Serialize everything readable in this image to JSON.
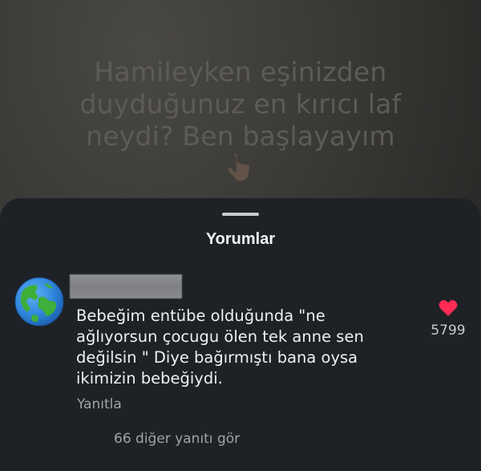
{
  "video": {
    "caption_lines": [
      "Hamileyken eşinizden",
      "duyduğunuz en kırıcı laf",
      "neydi? Ben başlayayım"
    ],
    "emoji": "pointing-down-hand"
  },
  "comments_sheet": {
    "title": "Yorumlar",
    "comment": {
      "avatar_icon": "earth-globe-americas-icon",
      "text_lines": [
        "Bebeğim entübe olduğunda \"ne",
        "ağlıyorsun çocugu ölen tek anne sen",
        "değilsin \" Diye bağırmıştı bana oysa",
        "ikimizin bebeğiydi."
      ],
      "reply_label": "Yanıtla",
      "like_icon": "heart-icon",
      "like_color": "#fe2c55",
      "like_count": "5799",
      "more_replies_label": "66 diğer yanıtı gör"
    }
  }
}
